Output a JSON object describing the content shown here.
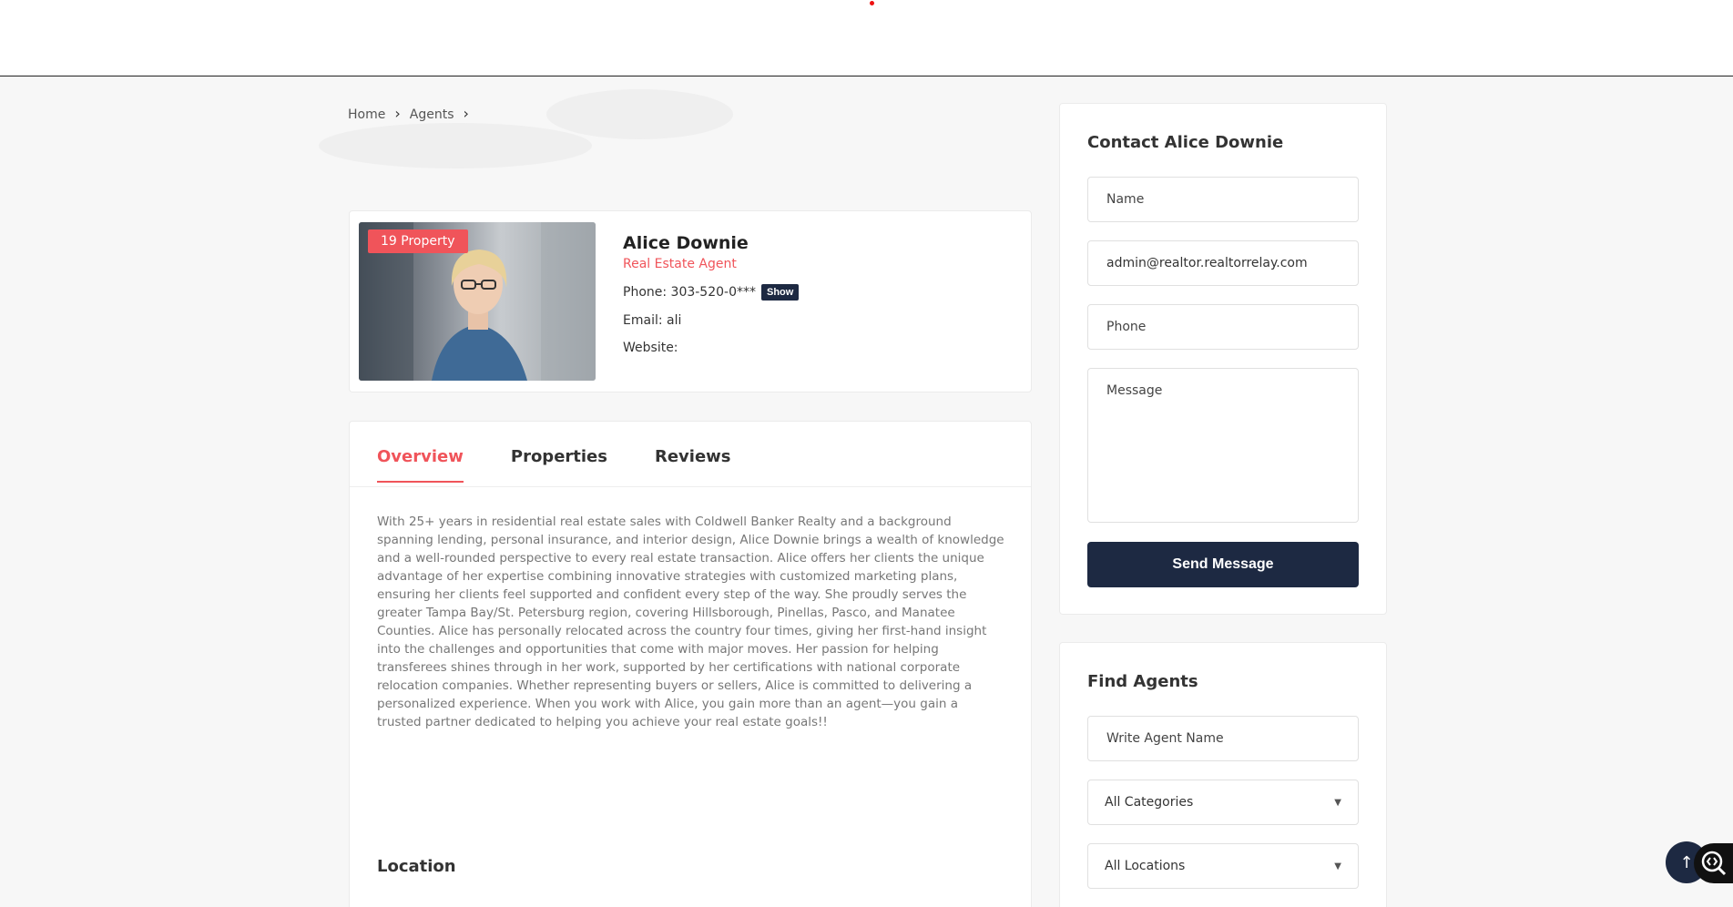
{
  "breadcrumb": {
    "home": "Home",
    "agents": "Agents"
  },
  "agent": {
    "badge": "19 Property",
    "name": "Alice Downie",
    "role": "Real Estate Agent",
    "phone_label": "Phone: 303-520-0***",
    "show_label": "Show",
    "email_label": "Email: ali",
    "website_label": "Website:"
  },
  "tabs": {
    "overview": "Overview",
    "properties": "Properties",
    "reviews": "Reviews"
  },
  "overview_text": "With 25+ years  in residential real estate sales with Coldwell Banker Realty and a background spanning lending, personal insurance, and interior design, Alice Downie brings a wealth of knowledge and a well-rounded perspective to every real estate transaction.  Alice offers her clients the unique advantage of  her expertise combining innovative strategies with customized marketing plans, ensuring her clients feel supported and confident every step of the way.  She proudly serves the greater Tampa Bay/St. Petersburg region, covering Hillsborough, Pinellas, Pasco, and Manatee Counties.  Alice has personally relocated across the country four times, giving her first-hand insight into the challenges and opportunities that come with major moves. Her passion for helping transferees shines through in her work, supported by her certifications with national corporate relocation companies. Whether representing buyers or sellers, Alice is committed to delivering a personalized experience. When you work with Alice, you gain more than an agent—you gain a trusted partner dedicated to helping you achieve your real estate goals!!",
  "location_title": "Location",
  "contact": {
    "title": "Contact Alice Downie",
    "name_placeholder": "Name",
    "email_value": "admin@realtor.realtorrelay.com",
    "phone_placeholder": "Phone",
    "message_placeholder": "Message",
    "send_label": "Send Message"
  },
  "find_agents": {
    "title": "Find Agents",
    "name_placeholder": "Write Agent Name",
    "category_selected": "All Categories",
    "location_selected": "All Locations"
  },
  "colors": {
    "accent": "#f0545a",
    "navy": "#1d2942"
  },
  "icons": {
    "scroll_top": "arrow-up-icon",
    "accessibility": "accessibility-icon",
    "caret": "caret-down-icon",
    "chevron": "chevron-right-icon"
  }
}
